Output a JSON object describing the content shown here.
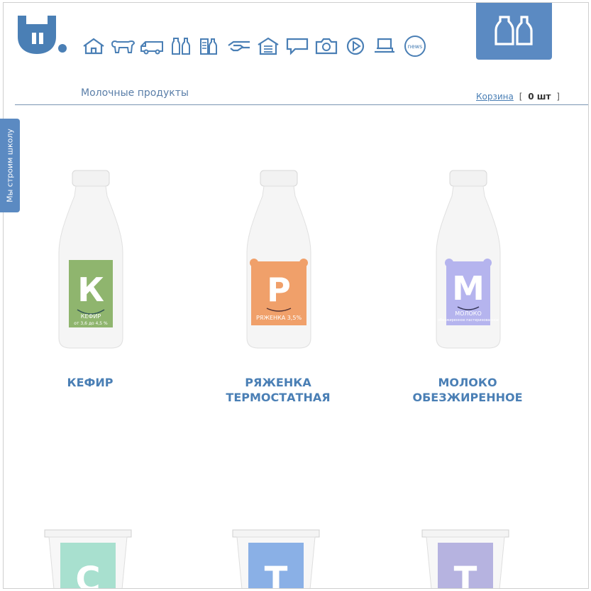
{
  "nav": {
    "icons": [
      "home-icon",
      "cow-icon",
      "truck-icon",
      "bottles-icon",
      "shelf-icon",
      "handshake-icon",
      "store-icon",
      "chat-icon",
      "camera-icon",
      "play-icon",
      "cup-icon"
    ],
    "news_label": "news"
  },
  "breadcrumb": "Молочные продукты",
  "cart": {
    "link_label": "Корзина",
    "open_bracket": "[",
    "count": "0 шт",
    "close_bracket": "]"
  },
  "side_tab": "Мы строим школу",
  "products": [
    {
      "name_line1": "КЕФИР",
      "name_line2": "",
      "label_letter": "К",
      "label_text": "КЕФИР",
      "label_sub": "от 3,6 до 4,5 %",
      "label_color": "#8fb56e"
    },
    {
      "name_line1": "РЯЖЕНКА",
      "name_line2": "ТЕРМОСТАТНАЯ",
      "label_letter": "Р",
      "label_text": "РЯЖЕНКА 3,5%",
      "label_sub": "",
      "label_color": "#f0a06a"
    },
    {
      "name_line1": "МОЛОКО",
      "name_line2": "ОБЕЗЖИРЕННОЕ",
      "label_letter": "М",
      "label_text": "МОЛОКО",
      "label_sub": "обезжиренное пастеризованное",
      "label_color": "#b5b4ee"
    }
  ],
  "cups": [
    {
      "label_letter": "С",
      "label_color": "#a8e0cf"
    },
    {
      "label_letter": "Т",
      "label_color": "#8ab0e6"
    },
    {
      "label_letter": "Т",
      "label_color": "#b6b3e0"
    }
  ],
  "colors": {
    "accent": "#5b8ac2",
    "text_blue": "#4a7fb5"
  }
}
